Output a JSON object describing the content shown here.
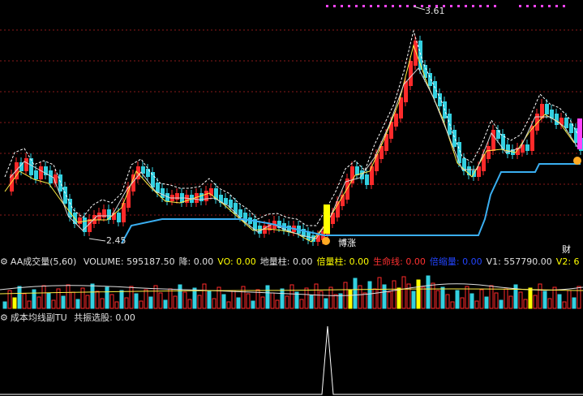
{
  "main": {
    "high_label": "3.61",
    "low_label": "2.45",
    "tag_label": "博涨",
    "right_tag": "财"
  },
  "volume_legend": {
    "name": "AA成交量(5,60)",
    "items": [
      {
        "label": "VOLUME: 595187.50",
        "color": "#e0e0e0"
      },
      {
        "label": "降: 0.00",
        "color": "#e0e0e0"
      },
      {
        "label": "VO: 0.00",
        "color": "#ffff00"
      },
      {
        "label": "地量柱: 0.00",
        "color": "#e0e0e0"
      },
      {
        "label": "倍量柱: 0.00",
        "color": "#ffff00"
      },
      {
        "label": "生命线: 0.00",
        "color": "#ff3030"
      },
      {
        "label": "倍缩量: 0.00",
        "color": "#2244ff"
      },
      {
        "label": "V1: 557790.00",
        "color": "#e0e0e0"
      },
      {
        "label": "V2: 6",
        "color": "#ffff00"
      }
    ]
  },
  "indicator_legend": {
    "name": "成本均线副TU",
    "items": [
      {
        "label": "共振选股: 0.00",
        "color": "#e0e0e0"
      }
    ]
  },
  "colors": {
    "up": "#ff2a2a",
    "down": "#33d0e0",
    "support_line": "#3aaef0",
    "ma_short": "#ffffff",
    "ma_long": "#ffee44",
    "signal": "#ffff00",
    "magenta": "#ff44ff",
    "grid": "#8a1a1a"
  }
}
